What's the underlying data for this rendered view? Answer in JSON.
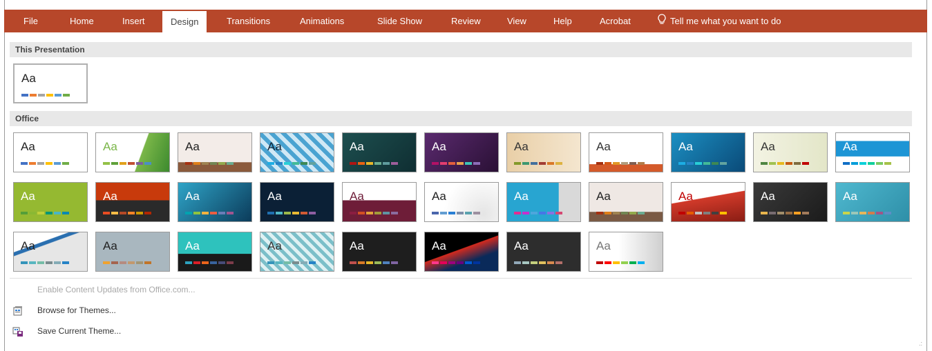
{
  "ribbon": {
    "color": "#b7472a",
    "tabs": [
      {
        "label": "File"
      },
      {
        "label": "Home"
      },
      {
        "label": "Insert"
      },
      {
        "label": "Design",
        "active": true
      },
      {
        "label": "Transitions"
      },
      {
        "label": "Animations"
      },
      {
        "label": "Slide Show"
      },
      {
        "label": "Review"
      },
      {
        "label": "View"
      },
      {
        "label": "Help"
      },
      {
        "label": "Acrobat"
      }
    ],
    "tell_me": "Tell me what you want to do",
    "tell_me_icon": "lightbulb-icon"
  },
  "gallery": {
    "this_presentation_header": "This Presentation",
    "office_header": "Office",
    "aa": "Aa"
  },
  "menu": {
    "enable_updates": "Enable Content Updates from Office.com...",
    "browse_themes": "Browse for Themes...",
    "save_theme": "Save Current Theme..."
  }
}
